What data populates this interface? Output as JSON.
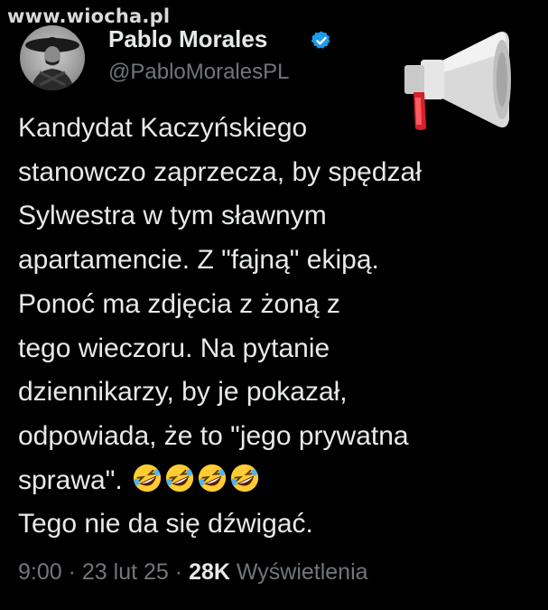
{
  "watermark": "www.wiocha.pl",
  "author": {
    "display_name": "Pablo Morales",
    "handle": "@PabloMoralesPL",
    "verified": true
  },
  "tweet": {
    "lines": [
      "Kandydat Kaczyńskiego",
      "stanowczo zaprzecza, by spędzał",
      "Sylwestra w tym sławnym",
      "apartamencie. Z \"fajną\" ekipą.",
      "Ponoć ma zdjęcia z żoną z",
      "tego wieczoru. Na pytanie",
      "dziennikarzy, by je pokazał,",
      "odpowiada, że to \"jego prywatna",
      "sprawa\".",
      "Tego nie da się dźwigać."
    ],
    "emoji": [
      "rolling-on-floor-laughing",
      "rolling-on-floor-laughing",
      "rolling-on-floor-laughing",
      "rolling-on-floor-laughing"
    ],
    "header_icon": "megaphone-icon"
  },
  "meta": {
    "time": "9:00",
    "separator": "·",
    "date": "23 lut 25",
    "views_count": "28K",
    "views_label": "Wyświetlenia"
  },
  "colors": {
    "background": "#000000",
    "text": "#e7e9ea",
    "secondary": "#71767b",
    "verified": "#1d9bf0"
  }
}
